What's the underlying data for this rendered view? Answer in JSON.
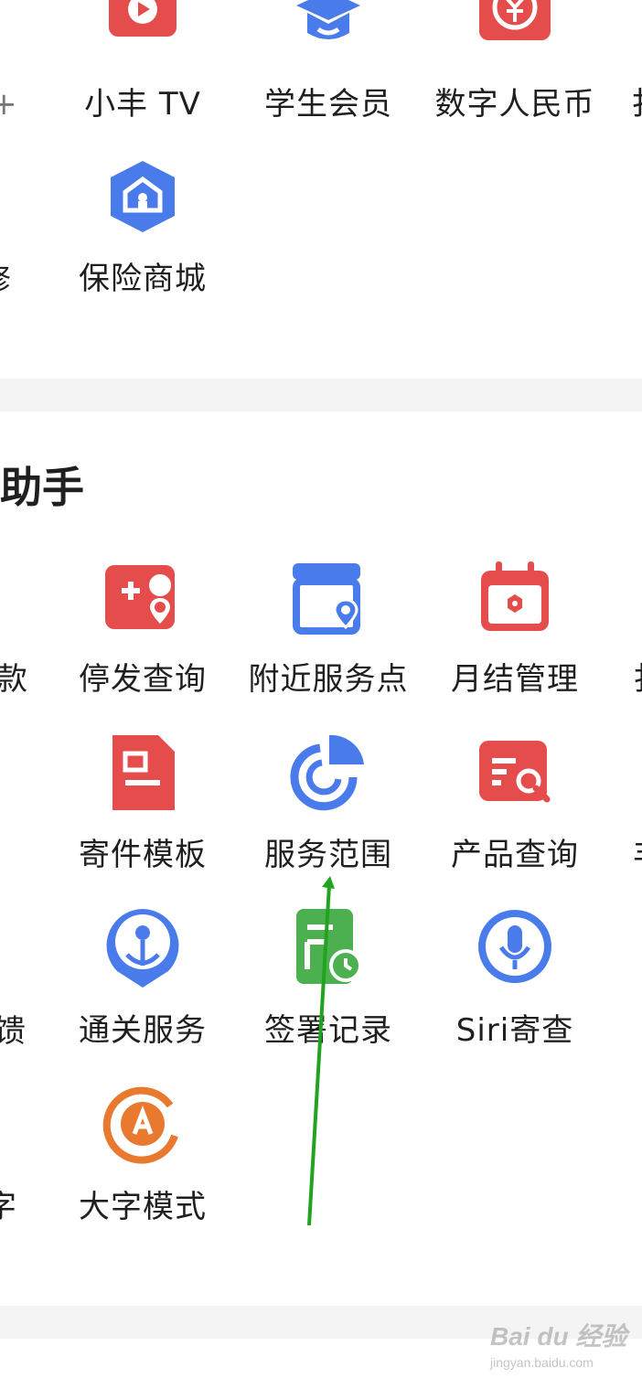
{
  "top_grid": {
    "row1": [
      {
        "label": "小丰 TV",
        "icon": "tv-play-icon"
      },
      {
        "label": "学生会员",
        "icon": "graduation-cap-icon"
      },
      {
        "label": "数字人民币",
        "icon": "digital-rmb-icon"
      }
    ],
    "row2": [
      {
        "label": "保险商城",
        "icon": "insurance-home-icon"
      }
    ],
    "left_edge_row2": "修"
  },
  "assistant": {
    "title": "助手",
    "left_edge": [
      "款",
      "馈",
      "字"
    ],
    "row1": [
      {
        "label": "停发查询",
        "icon": "card-location-icon"
      },
      {
        "label": "附近服务点",
        "icon": "store-location-icon"
      },
      {
        "label": "月结管理",
        "icon": "calendar-icon"
      }
    ],
    "row2": [
      {
        "label": "寄件模板",
        "icon": "document-template-icon"
      },
      {
        "label": "服务范围",
        "icon": "pie-chart-icon"
      },
      {
        "label": "产品查询",
        "icon": "search-document-icon"
      }
    ],
    "row3": [
      {
        "label": "通关服务",
        "icon": "anchor-location-icon"
      },
      {
        "label": "签署记录",
        "icon": "signed-clock-icon"
      },
      {
        "label": "Siri寄查",
        "icon": "microphone-icon"
      }
    ],
    "row4": [
      {
        "label": "大字模式",
        "icon": "large-font-a-icon"
      }
    ]
  },
  "watermark": {
    "brand": "Bai du 经验",
    "url": "jingyan.baidu.com"
  },
  "colors": {
    "red": "#e54d4d",
    "blue": "#4a7bea",
    "green": "#4caf50",
    "orange": "#e8792f",
    "arrow": "#22a31f"
  }
}
